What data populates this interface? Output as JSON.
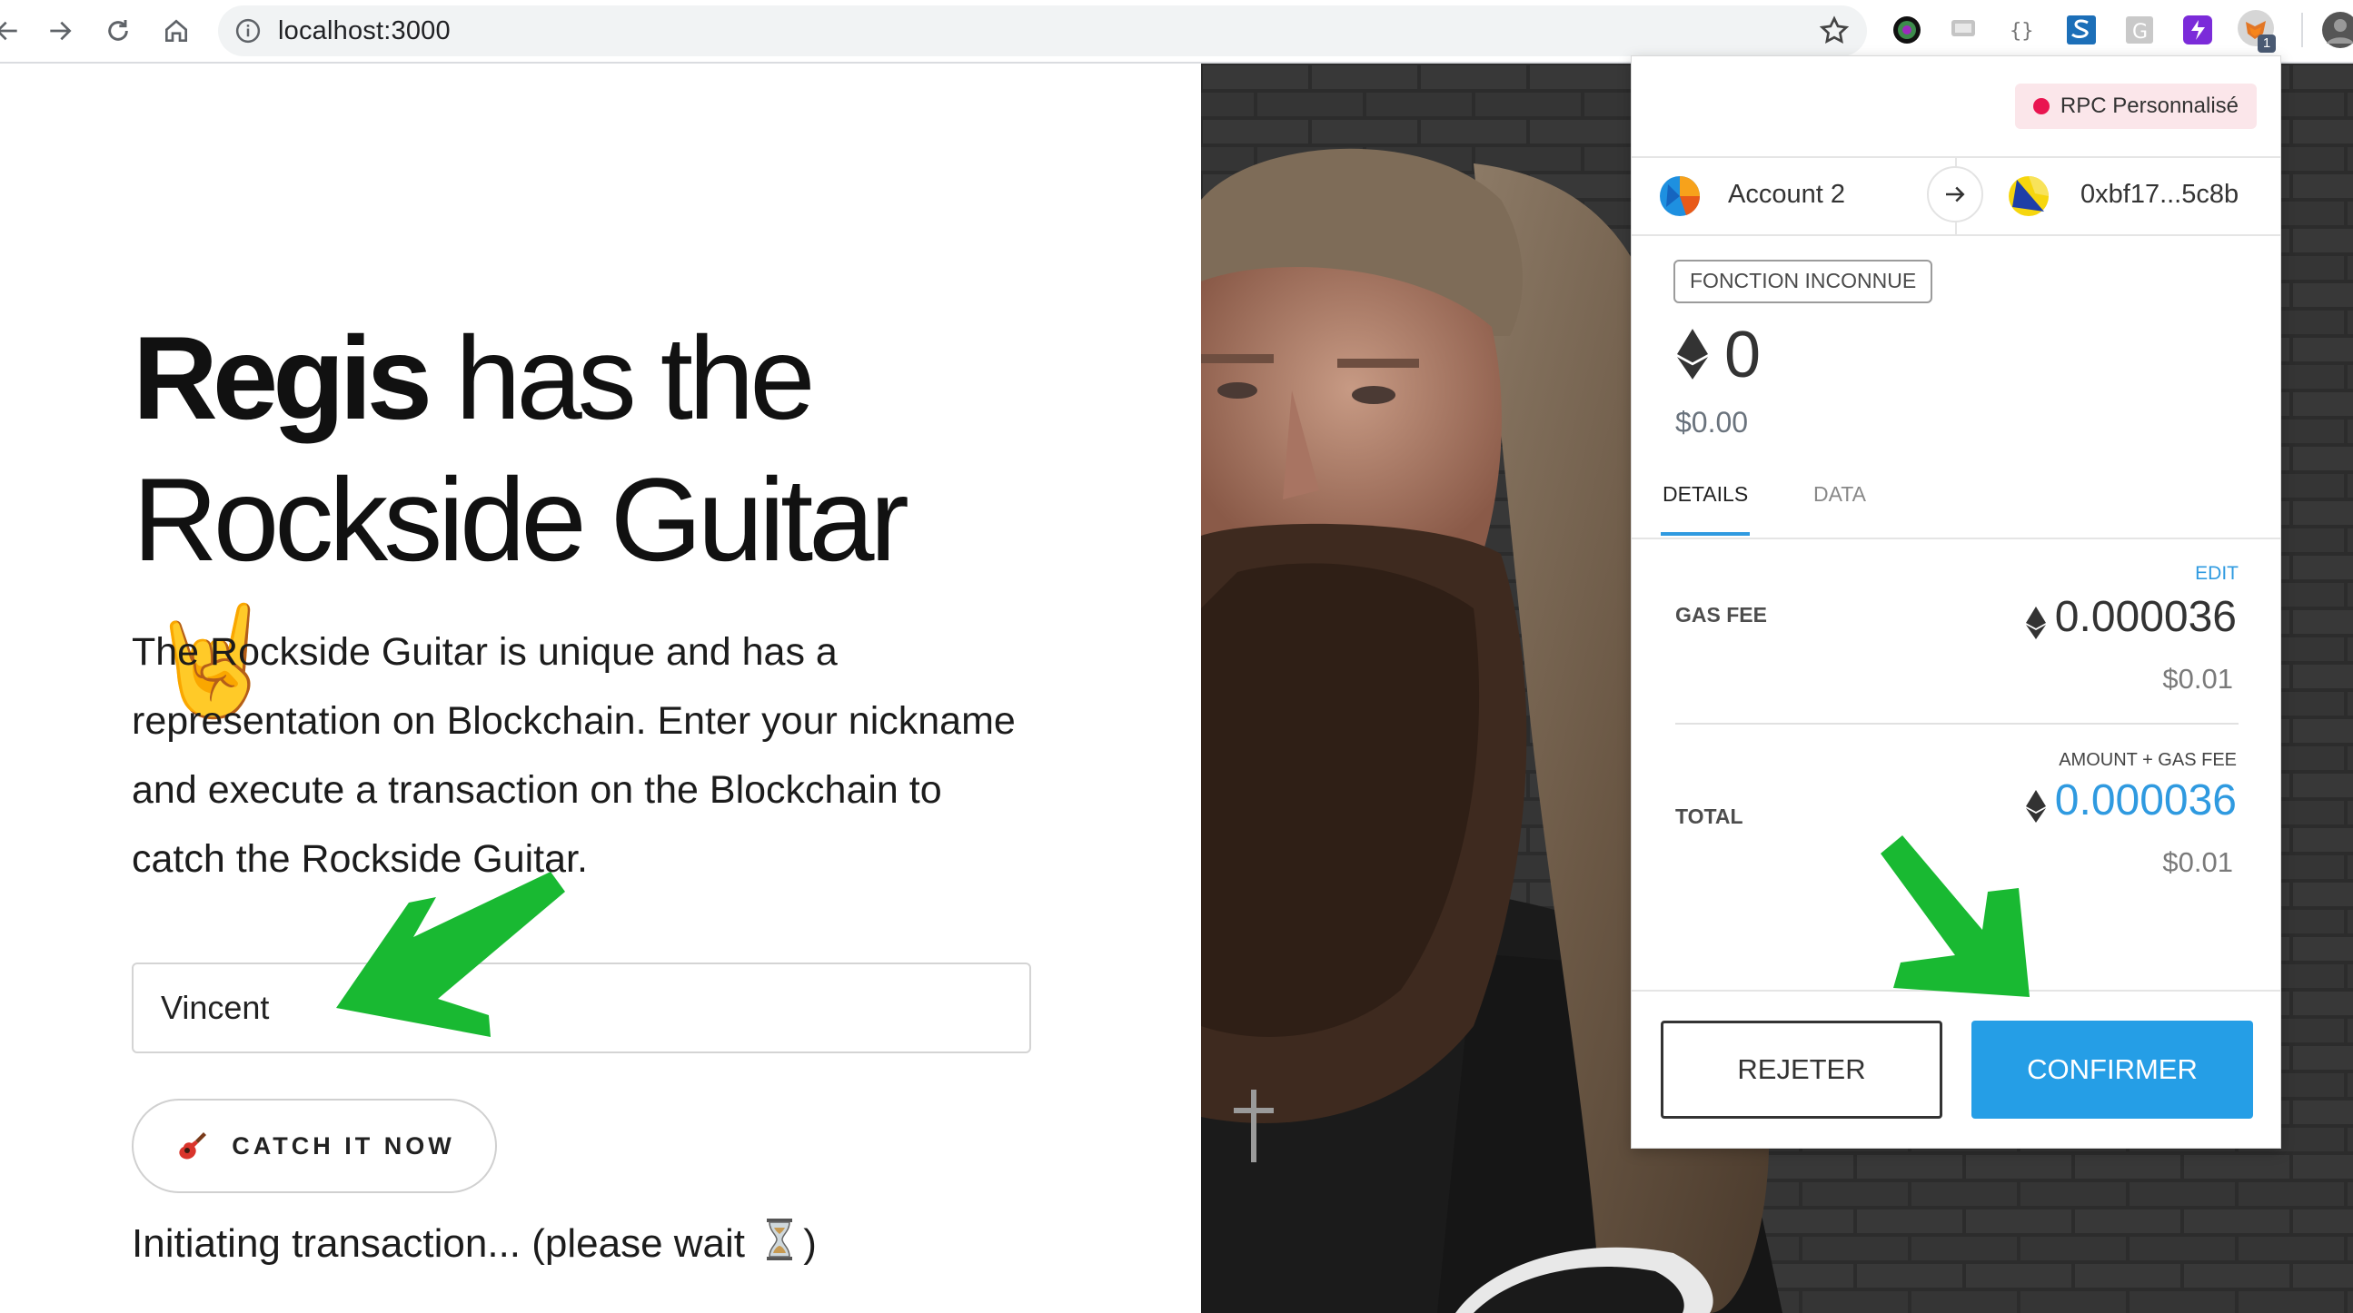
{
  "browser": {
    "url": "localhost:3000",
    "extension_badge": "1"
  },
  "page": {
    "headline_strong": "Regis",
    "headline_rest": " has the",
    "headline_line2": "Rockside Guitar",
    "headline_emoji": "🤘",
    "intro_lines": [
      "The Rockside Guitar is unique and has a",
      "representation on Blockchain. Enter your nickname",
      "and execute a transaction on the Blockchain to",
      "catch the Rockside Guitar."
    ],
    "nickname_value": "Vincent",
    "catch_button_label": "CATCH IT NOW",
    "status_text": "Initiating transaction... (please wait",
    "status_close": ")"
  },
  "metamask": {
    "network": "RPC Personnalisé",
    "from_account": "Account 2",
    "to_address": "0xbf17...5c8b",
    "method": "FONCTION INCONNUE",
    "eth_amount": "0",
    "fiat_amount": "$0.00",
    "tabs": [
      "DETAILS",
      "DATA"
    ],
    "edit_label": "EDIT",
    "gas_fee_label": "GAS FEE",
    "gas_fee_eth": "0.000036",
    "gas_fee_fiat": "$0.01",
    "total_caption": "AMOUNT + GAS FEE",
    "total_label": "TOTAL",
    "total_eth": "0.000036",
    "total_fiat": "$0.01",
    "reject_label": "REJETER",
    "confirm_label": "CONFIRMER"
  },
  "colors": {
    "accent_blue": "#259ee6",
    "network_dot": "#e91550",
    "annotation_green": "#19b932"
  }
}
